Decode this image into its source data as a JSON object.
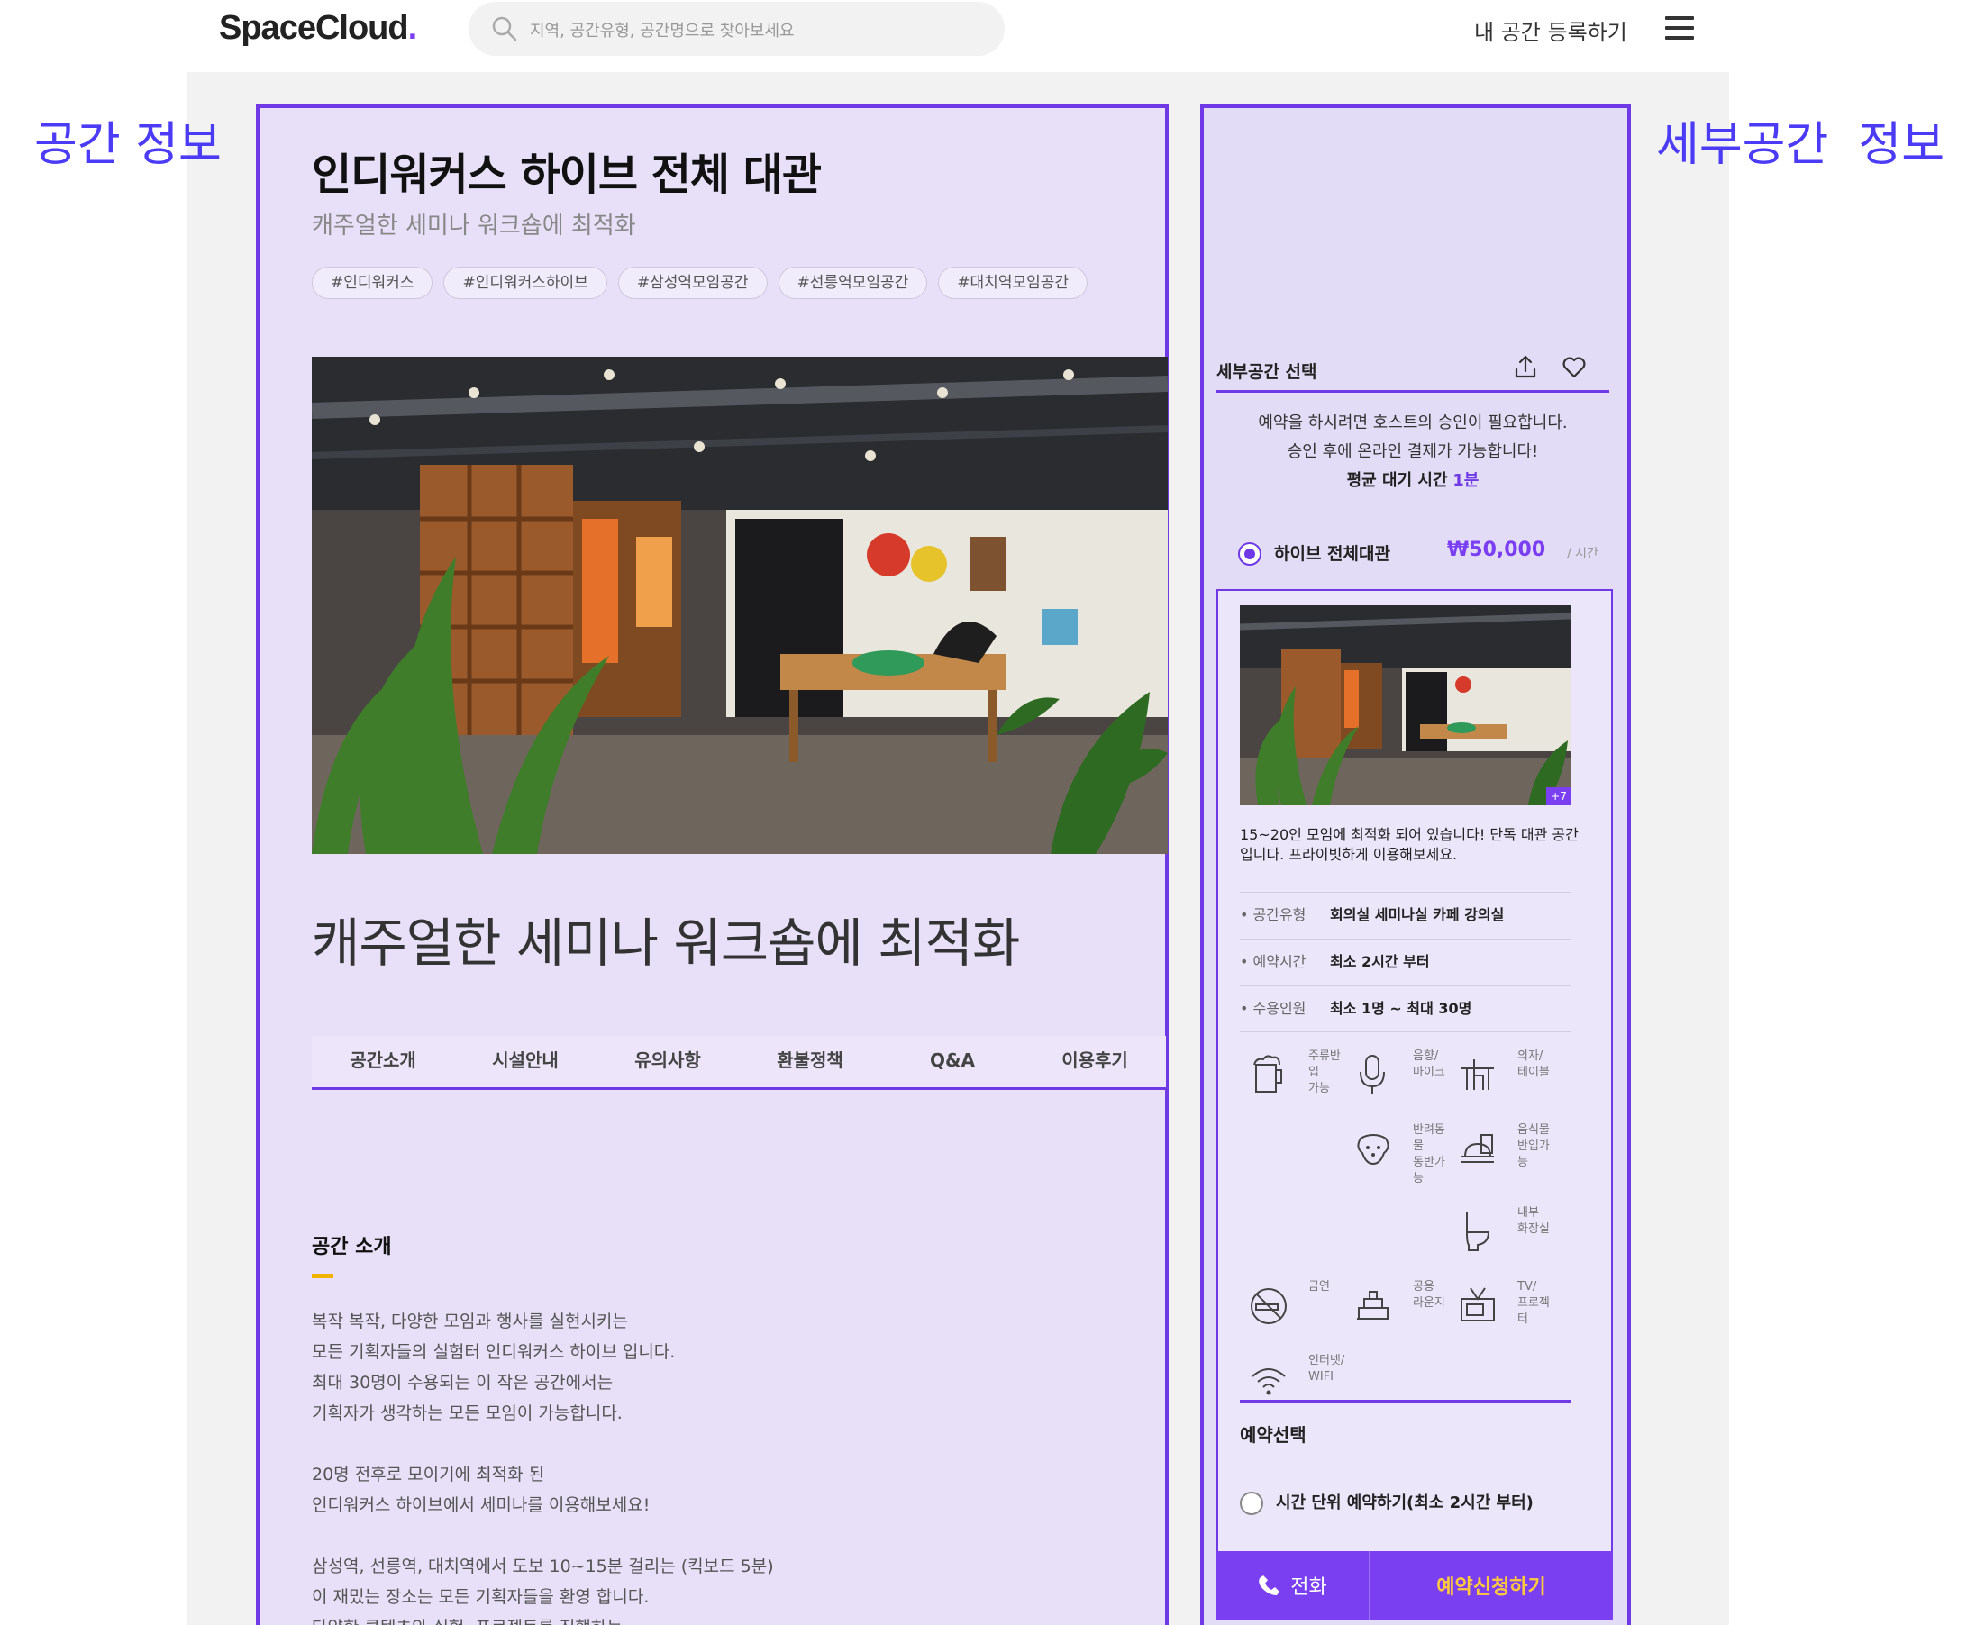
{
  "header": {
    "logo": "SpaceCloud",
    "logo_dot": ".",
    "search_placeholder": "지역, 공간유형, 공간명으로 찾아보세요",
    "register_link": "내 공간 등록하기"
  },
  "labels": {
    "left": "공간 정보",
    "right": "세부공간  정보"
  },
  "space": {
    "title": "인디워커스 하이브 전체 대관",
    "subtitle": "캐주얼한 세미나 워크숍에 최적화",
    "tags": [
      "#인디워커스",
      "#인디워커스하이브",
      "#삼성역모임공간",
      "#선릉역모임공간",
      "#대치역모임공간"
    ],
    "headline": "캐주얼한 세미나 워크숍에 최적화",
    "tabs": [
      "공간소개",
      "시설안내",
      "유의사항",
      "환불정책",
      "Q&A",
      "이용후기"
    ],
    "intro_title": "공간 소개",
    "intro_text": "복작 복작, 다양한 모임과 행사를 실현시키는\n모든 기획자들의 실험터 인디워커스 하이브 입니다.\n최대 30명이 수용되는 이 작은 공간에서는\n기획자가 생각하는 모든 모임이 가능합니다.\n\n20명 전후로 모이기에 최적화 된\n인디워커스 하이브에서 세미나를 이용해보세요!\n\n삼성역, 선릉역, 대치역에서 도보 10~15분 걸리는 (킥보드 5분)\n이 재밌는 장소는 모든 기획자들을 환영 합니다.\n다양한 콘텐츠와 실험, 프로젝트를 진행하는"
  },
  "detail": {
    "select_title": "세부공간 선택",
    "notice_line1": "예약을 하시려면 호스트의 승인이 필요합니다.",
    "notice_line2": "승인 후에 온라인 결제가 가능합니다!",
    "wait_label": "평균 대기 시간",
    "wait_value": "1분",
    "option_name": "하이브 전체대관",
    "option_price": "₩50,000",
    "option_unit": "/ 시간",
    "photo_count": "+7",
    "description": "15~20인 모임에 최적화 되어 있습니다! 단독 대관 공간 입니다. 프라이빗하게 이용해보세요.",
    "info": [
      {
        "key": "• 공간유형",
        "value": "회의실 세미나실 카페 강의실"
      },
      {
        "key": "• 예약시간",
        "value": "최소 2시간 부터"
      },
      {
        "key": "• 수용인원",
        "value": "최소 1명 ~ 최대 30명"
      }
    ],
    "facilities": [
      {
        "icon": "beer-icon",
        "label": "주류반\n입\n가능"
      },
      {
        "icon": "microphone-icon",
        "label": "음향/\n마이크"
      },
      {
        "icon": "table-chair-icon",
        "label": "의자/\n테이블"
      },
      {
        "icon": "pet-icon",
        "label": "반려동\n물\n동반가\n능"
      },
      {
        "icon": "food-icon",
        "label": "음식물\n반입가\n능"
      },
      {
        "icon": "toilet-icon",
        "label": "내부\n화장실"
      },
      {
        "icon": "no-smoking-icon",
        "label": "금연"
      },
      {
        "icon": "lounge-icon",
        "label": "공용\n라운지"
      },
      {
        "icon": "tv-icon",
        "label": "TV/\n프로젝\n터"
      },
      {
        "icon": "wifi-icon",
        "label": "인터넷/\nWIFI"
      }
    ],
    "reservation_title": "예약선택",
    "reservation_option": "시간 단위 예약하기(최소 2시간 부터)",
    "call_label": "전화",
    "book_label": "예약신청하기"
  },
  "colors": {
    "accent": "#7b3ff2",
    "panel_border": "#6f3ae6",
    "label_blue": "#4b3bf5",
    "book_text": "#ffc93c",
    "tag_bar": "#f0b400"
  }
}
